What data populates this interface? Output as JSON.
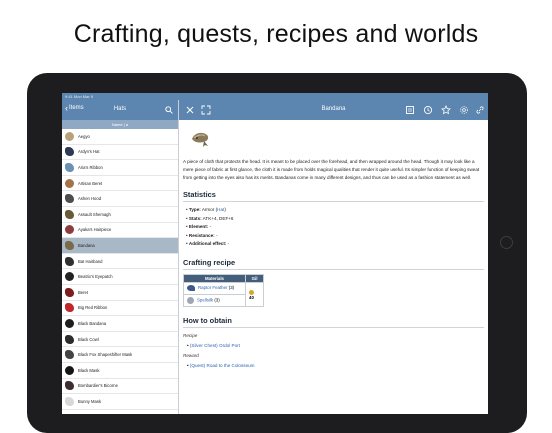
{
  "headline": "Crafting, quests, recipes and worlds",
  "status": {
    "time": "9:41  Mon Mar 9"
  },
  "left": {
    "back_label": "Items",
    "title": "Hats",
    "sort_label": "Name | a",
    "items": [
      "Aegyo",
      "Ardyn's Hat",
      "Aria's Ribbon",
      "Artisan Beret",
      "Ashen Hood",
      "Assault Shemagh",
      "Ayaka's Hairpiece",
      "Bandana",
      "Bat Hairband",
      "Beatrix's Eyepatch",
      "Beret",
      "Big Red Ribbon",
      "Black Bandana",
      "Black Cowl",
      "Black Fox Shapeshifter Mask",
      "Black Mask",
      "Bombardier's Bicorne",
      "Bunny Mask"
    ],
    "selected_index": 7
  },
  "right": {
    "title": "Bandana",
    "description": "A piece of cloth that protects the head. It is meant to be placed over the forehead, and then wrapped around the head. Though it may look like a mere piece of fabric at first glance, the cloth it is made from holds magical qualities that render it quite useful. Its simpler function of keeping sweat from getting into the eyes also has its merits. Bandanas come in many different designs, and thus can be used as a fashion statement as well.",
    "statistics_heading": "Statistics",
    "stats": [
      {
        "label": "Type:",
        "value": " Armor (",
        "link": "Hat",
        "tail": ")"
      },
      {
        "label": "Stats:",
        "value": " ATK+4, DEF+6",
        "link": "",
        "tail": ""
      },
      {
        "label": "Element:",
        "value": " -",
        "link": "",
        "tail": ""
      },
      {
        "label": "Resistance:",
        "value": " -",
        "link": "",
        "tail": ""
      },
      {
        "label": "Additional effect:",
        "value": " -",
        "link": "",
        "tail": ""
      }
    ],
    "recipe_heading": "Crafting recipe",
    "recipe_table": {
      "col_materials": "Materials",
      "col_gil": "Gil",
      "materials": [
        {
          "name": "Raptor Feather",
          "qty": "(3)"
        },
        {
          "name": "Spellsilk",
          "qty": "(3)"
        }
      ],
      "gil": "40"
    },
    "obtain_heading": "How to obtain",
    "obtain": [
      {
        "category": "Recipe",
        "tag": "(Silver Chest)",
        "place": "Ordol Port"
      },
      {
        "category": "Reward",
        "tag": "(Quest)",
        "place": "Road to the Colosseum"
      }
    ]
  },
  "colors": {
    "navbar": "#5c86b0",
    "selected_row": "#a9b8c7",
    "link": "#2d64b4",
    "table_header": "#435d7a"
  }
}
